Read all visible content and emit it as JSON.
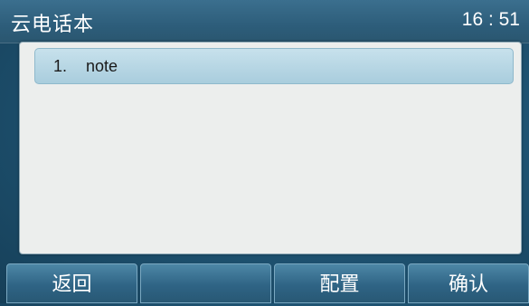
{
  "header": {
    "title": "云电话本",
    "time": "16 : 51"
  },
  "list": {
    "items": [
      {
        "index": "1.",
        "label": "note"
      }
    ]
  },
  "softkeys": {
    "back": "返回",
    "empty": "",
    "config": "配置",
    "confirm": "确认"
  }
}
